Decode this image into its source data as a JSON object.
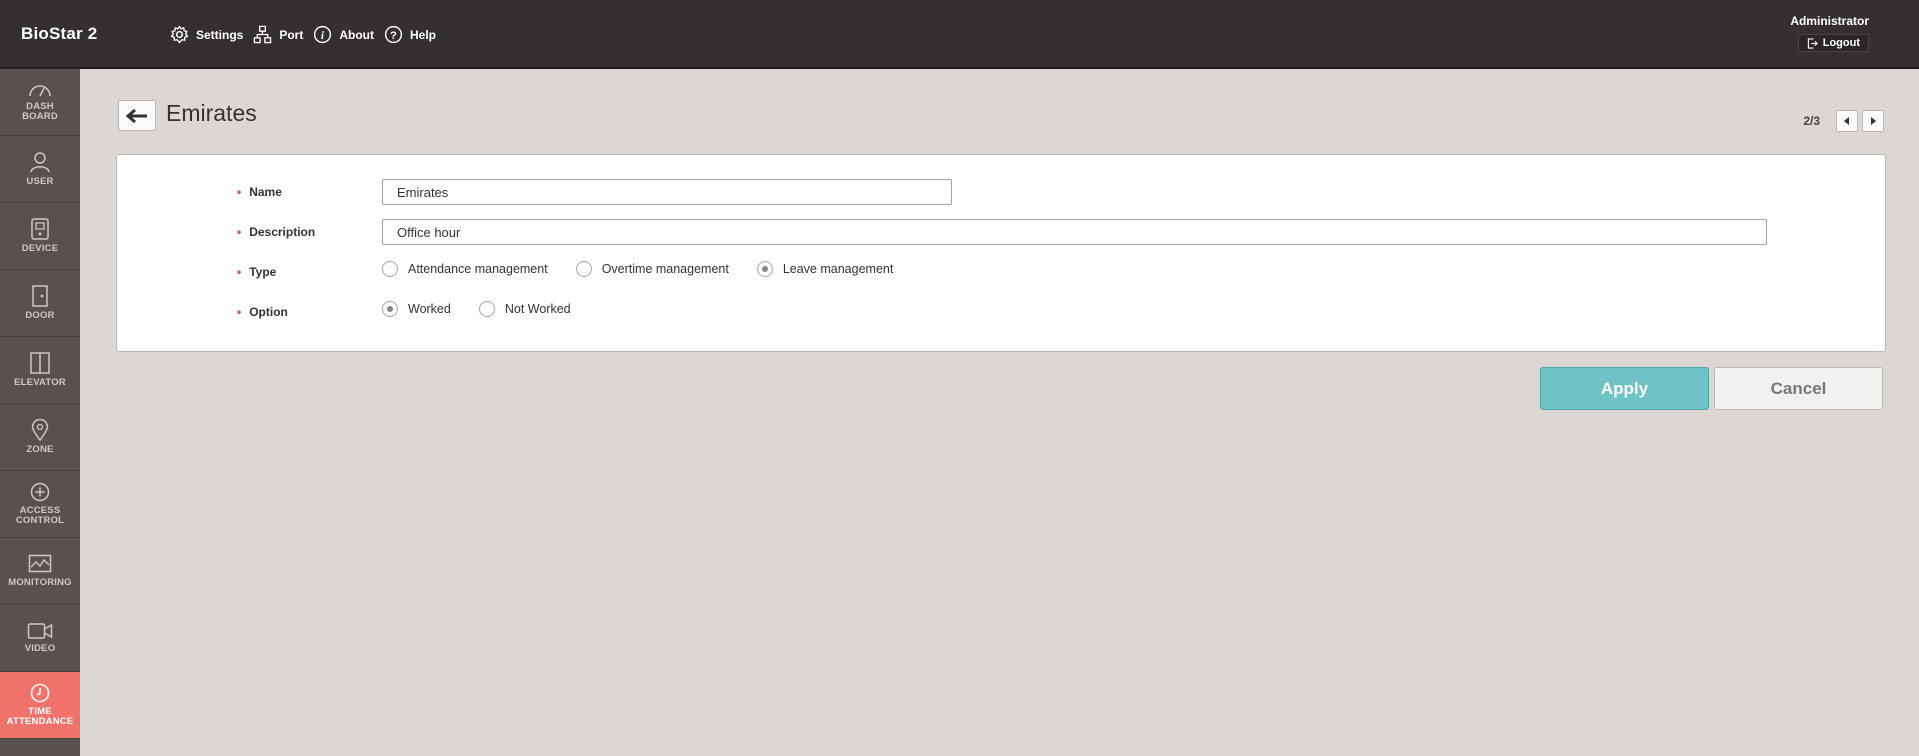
{
  "app": {
    "brand": "BioStar 2"
  },
  "topnav": {
    "settings": "Settings",
    "port": "Port",
    "about": "About",
    "help": "Help"
  },
  "user": {
    "name": "Administrator",
    "logout": "Logout"
  },
  "sidebar": {
    "items": [
      {
        "label_line1": "DASH",
        "label_line2": "BOARD",
        "icon": "dashboard-icon"
      },
      {
        "label_line1": "USER",
        "label_line2": "",
        "icon": "user-icon"
      },
      {
        "label_line1": "DEVICE",
        "label_line2": "",
        "icon": "device-icon"
      },
      {
        "label_line1": "DOOR",
        "label_line2": "",
        "icon": "door-icon"
      },
      {
        "label_line1": "ELEVATOR",
        "label_line2": "",
        "icon": "elevator-icon"
      },
      {
        "label_line1": "ZONE",
        "label_line2": "",
        "icon": "zone-icon"
      },
      {
        "label_line1": "ACCESS",
        "label_line2": "CONTROL",
        "icon": "access-control-icon"
      },
      {
        "label_line1": "MONITORING",
        "label_line2": "",
        "icon": "monitoring-icon"
      },
      {
        "label_line1": "VIDEO",
        "label_line2": "",
        "icon": "video-icon"
      },
      {
        "label_line1": "TIME",
        "label_line2": "ATTENDANCE",
        "icon": "time-attendance-icon",
        "active": true
      }
    ],
    "active_color": "#f0726a"
  },
  "page": {
    "title": "Emirates",
    "pager": "2/3"
  },
  "form": {
    "required_mark": "•",
    "name": {
      "label": "Name",
      "value": "Emirates"
    },
    "description": {
      "label": "Description",
      "value": "Office hour"
    },
    "type": {
      "label": "Type",
      "options": [
        "Attendance management",
        "Overtime management",
        "Leave management"
      ],
      "selected": "Leave management"
    },
    "option": {
      "label": "Option",
      "options": [
        "Worked",
        "Not Worked"
      ],
      "selected": "Worked"
    }
  },
  "actions": {
    "apply": "Apply",
    "cancel": "Cancel",
    "apply_color": "#6fc2c6"
  }
}
